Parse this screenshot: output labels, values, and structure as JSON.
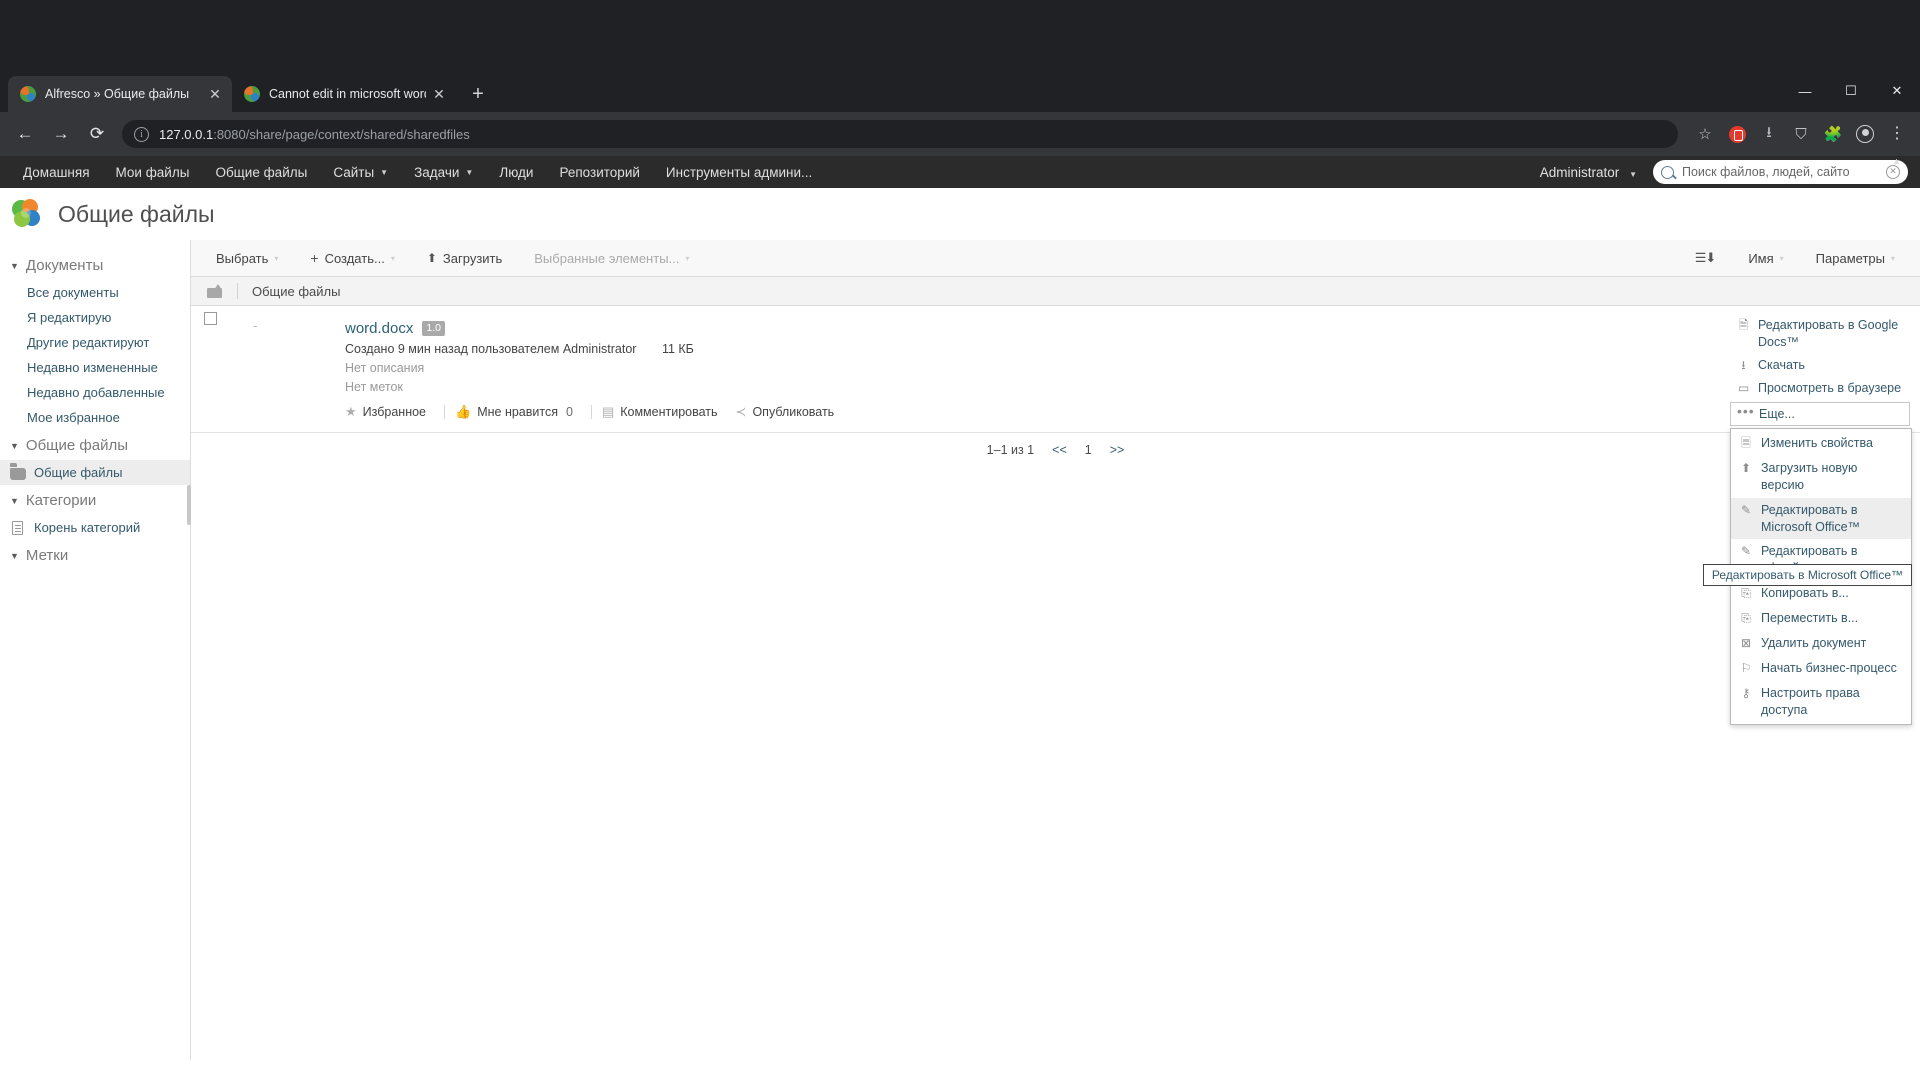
{
  "browser": {
    "tabs": [
      {
        "title": "Alfresco » Общие файлы",
        "active": true,
        "close": "✕",
        "favicon": "alfresco-favicon"
      },
      {
        "title": "Cannot edit in microsoft word so",
        "active": false,
        "close": "✕",
        "favicon": "alfresco-favicon"
      }
    ],
    "new_tab_label": "+",
    "window_controls": {
      "minimize": "—",
      "maximize": "☐",
      "close": "✕"
    },
    "nav": {
      "back": "←",
      "forward": "→",
      "reload": "⟳"
    },
    "omnibox": {
      "info_icon": "ⓘ",
      "host": "127.0.0.1",
      "rest": ":8080/share/page/context/shared/sharedfiles"
    },
    "omnibox_icons": [
      "star-icon",
      "extension-red-icon",
      "download-icon",
      "shield-icon",
      "puzzle-icon",
      "profile-icon",
      "menu-kebab-icon"
    ]
  },
  "alfresco": {
    "nav_items": [
      {
        "label": "Домашняя",
        "caret": false
      },
      {
        "label": "Мои файлы",
        "caret": false
      },
      {
        "label": "Общие файлы",
        "caret": false
      },
      {
        "label": "Сайты",
        "caret": true
      },
      {
        "label": "Задачи",
        "caret": true
      },
      {
        "label": "Люди",
        "caret": false
      },
      {
        "label": "Репозиторий",
        "caret": false
      },
      {
        "label": "Инструменты админи...",
        "caret": false
      }
    ],
    "user": "Administrator",
    "user_caret": "▾",
    "search": {
      "placeholder": "Поиск файлов, людей, сайто",
      "value": "",
      "clear": "✕"
    },
    "page_title": "Общие файлы",
    "sidebar": {
      "groups": [
        {
          "title": "Документы",
          "tri": "▼",
          "links": [
            {
              "label": "Все документы",
              "icon": "",
              "selected": false
            },
            {
              "label": "Я редактирую",
              "icon": "",
              "selected": false
            },
            {
              "label": "Другие редактируют",
              "icon": "",
              "selected": false
            },
            {
              "label": "Недавно измененные",
              "icon": "",
              "selected": false
            },
            {
              "label": "Недавно добавленные",
              "icon": "",
              "selected": false
            },
            {
              "label": "Мое избранное",
              "icon": "",
              "selected": false
            }
          ]
        },
        {
          "title": "Общие файлы",
          "tri": "▼",
          "links": [
            {
              "label": "Общие файлы",
              "icon": "folder-icon",
              "selected": true
            }
          ]
        },
        {
          "title": "Категории",
          "tri": "▼",
          "links": [
            {
              "label": "Корень категорий",
              "icon": "category-icon",
              "selected": false
            }
          ]
        },
        {
          "title": "Метки",
          "tri": "▼",
          "links": []
        }
      ]
    },
    "toolbar": {
      "select_label": "Выбрать",
      "create_label": "Создать...",
      "upload_label": "Загрузить",
      "selected_items_label": "Выбранные элементы...",
      "sort_icon": "sort-descending-icon",
      "sort_field_label": "Имя",
      "options_label": "Параметры",
      "caret": "▾",
      "plus": "+",
      "upload_icon": "⬆"
    },
    "breadcrumb": {
      "up_icon": "folder-up-icon",
      "label": "Общие файлы"
    },
    "document": {
      "checkbox_checked": false,
      "thumb_placeholder": "-",
      "name": "word.docx",
      "version": "1.0",
      "meta": "Создано 9 мин назад пользователем Administrator",
      "size": "11 КБ",
      "no_description": "Нет описания",
      "no_tags": "Нет меток",
      "actions": [
        {
          "label": "Избранное",
          "icon": "star-icon"
        },
        {
          "label": "Мне нравится",
          "icon": "thumbs-up-icon",
          "count": "0"
        },
        {
          "label": "Комментировать",
          "icon": "comment-icon"
        },
        {
          "label": "Опубликовать",
          "icon": "share-icon"
        }
      ]
    },
    "doc_aside": [
      {
        "label": "Редактировать в Google Docs™",
        "icon": "edit-doc-icon",
        "boxed": false
      },
      {
        "label": "Скачать",
        "icon": "download-icon",
        "boxed": false
      },
      {
        "label": "Просмотреть в браузере",
        "icon": "browser-view-icon",
        "boxed": false
      },
      {
        "label": "Еще...",
        "icon": "ellipsis-icon",
        "boxed": true
      }
    ],
    "more_menu": [
      {
        "label": "Изменить свойства",
        "icon": "properties-icon",
        "highlight": false
      },
      {
        "label": "Загрузить новую версию",
        "icon": "upload-version-icon",
        "highlight": false
      },
      {
        "label": "Редактировать в Microsoft Office™",
        "icon": "pencil-icon",
        "highlight": true
      },
      {
        "label": "Редактировать в офлайн режиме",
        "icon": "pencil-icon",
        "highlight": false
      },
      {
        "label": "Копировать в...",
        "icon": "copy-icon",
        "highlight": false
      },
      {
        "label": "Переместить в...",
        "icon": "move-icon",
        "highlight": false
      },
      {
        "label": "Удалить документ",
        "icon": "delete-icon",
        "highlight": false
      },
      {
        "label": "Начать бизнес-процесс",
        "icon": "workflow-icon",
        "highlight": false
      },
      {
        "label": "Настроить права доступа",
        "icon": "key-icon",
        "highlight": false
      }
    ],
    "tooltip": "Редактировать в Microsoft Office™",
    "pagination": {
      "range": "1–1 из 1",
      "prev": "<<",
      "current": "1",
      "next": ">>"
    }
  }
}
